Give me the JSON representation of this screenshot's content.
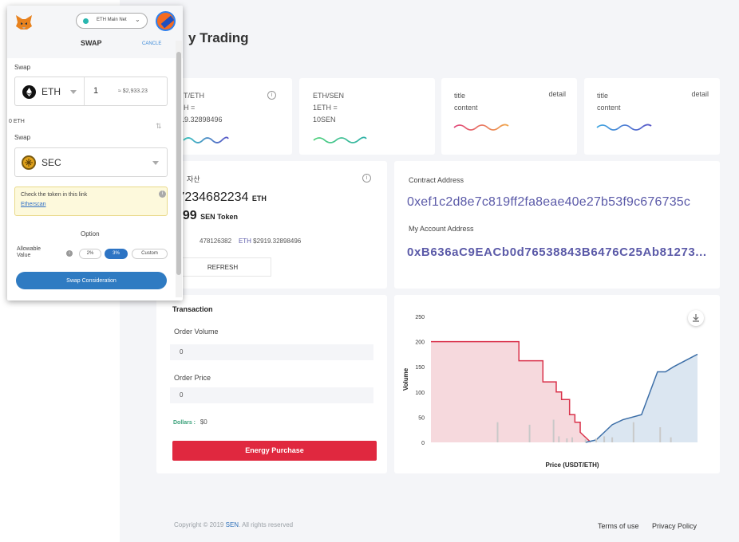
{
  "page": {
    "title": "y Trading"
  },
  "stat_cards": [
    {
      "line1": "T/ETH",
      "line2": "H =",
      "line3": "19.32898496",
      "detail": ""
    },
    {
      "line1": "ETH/SEN",
      "line2": "1ETH =",
      "line3": "10SEN",
      "detail": ""
    },
    {
      "line1": "title",
      "line2": "content",
      "line3": "",
      "detail": "detail"
    },
    {
      "line1": "title",
      "line2": "content",
      "line3": "",
      "detail": "detail"
    }
  ],
  "assets": {
    "label": "자산",
    "eth_amount": ".7234682234",
    "eth_unit": "ETH",
    "sen_amount": "999",
    "sen_unit": "SEN Token",
    "sub_num": "478126382",
    "sub_eth_label": "ETH",
    "sub_usd": "$2919.32898496",
    "refresh": "REFRESH"
  },
  "addresses": {
    "contract_label": "Contract Address",
    "contract_value": "0xef1c2d8e7c819ff2fa8eae40e27b53f9c676735c",
    "account_label": "My Account Address",
    "account_value": "0xB636aC9EACb0d76538843B6476C25Ab81273..."
  },
  "transaction": {
    "title": "Transaction",
    "volume_label": "Order Volume",
    "volume_value": "0",
    "price_label": "Order Price",
    "price_value": "0",
    "dollars_label": "Dollars :",
    "dollars_value": "$0",
    "buy_button": "Energy Purchase"
  },
  "chart_data": {
    "type": "area",
    "title": "",
    "xlabel": "Price (USDT/ETH)",
    "ylabel": "Volume",
    "ylim": [
      0,
      250
    ],
    "yticks": [
      0,
      50,
      100,
      150,
      200,
      250
    ],
    "colors": {
      "bid": "#d9314a",
      "ask": "#3d6fa8",
      "bid_fill": "#f6d9dd",
      "ask_fill": "#dbe6f1"
    },
    "series": [
      {
        "name": "",
        "side": "bid",
        "x": [
          0,
          0.33,
          0.33,
          0.42,
          0.42,
          0.47,
          0.47,
          0.49,
          0.49,
          0.52,
          0.52,
          0.54,
          0.54,
          0.56,
          0.56,
          0.6
        ],
        "values": [
          200,
          200,
          162,
          162,
          120,
          120,
          100,
          100,
          85,
          85,
          55,
          55,
          40,
          40,
          20,
          0
        ]
      },
      {
        "name": "",
        "side": "ask",
        "x": [
          0.58,
          0.62,
          0.62,
          0.65,
          0.65,
          0.68,
          0.68,
          0.72,
          0.72,
          0.79,
          0.79,
          0.85,
          0.85,
          0.88,
          0.88,
          0.91,
          0.91,
          1.0
        ],
        "values": [
          0,
          5,
          5,
          20,
          20,
          35,
          35,
          45,
          45,
          55,
          55,
          140,
          140,
          140,
          140,
          150,
          150,
          175
        ]
      }
    ],
    "bars_x": [
      0.25,
      0.37,
      0.46,
      0.48,
      0.51,
      0.53,
      0.58,
      0.62,
      0.65,
      0.68,
      0.76,
      0.86,
      0.9
    ],
    "bars_y": [
      40,
      35,
      45,
      12,
      8,
      10,
      6,
      8,
      12,
      10,
      40,
      30,
      10
    ]
  },
  "footer": {
    "copy_prefix": "Copyright © 2019 ",
    "copy_brand": "SEN",
    "copy_suffix": ". All rights reserved",
    "terms": "Terms of use",
    "privacy": "Privacy Policy"
  },
  "metamask": {
    "network": "ETH Main Net",
    "header_title": "SWAP",
    "cancel": "CANCLE",
    "swap_label_1": "Swap",
    "from_token": "ETH",
    "from_amount": "1",
    "from_usd": "≈ $2,933.23",
    "balance": "0 ETH",
    "swap_label_2": "Swap",
    "to_token": "SEC",
    "notice_text": "Check the token in this link",
    "notice_link": "Etherscan",
    "option_label": "Option",
    "allowable_label_1": "Allowable",
    "allowable_label_2": "Value",
    "pill_1": "2%",
    "pill_2": "3%",
    "pill_3": "Custom",
    "action_button": "Swap Consideration"
  }
}
